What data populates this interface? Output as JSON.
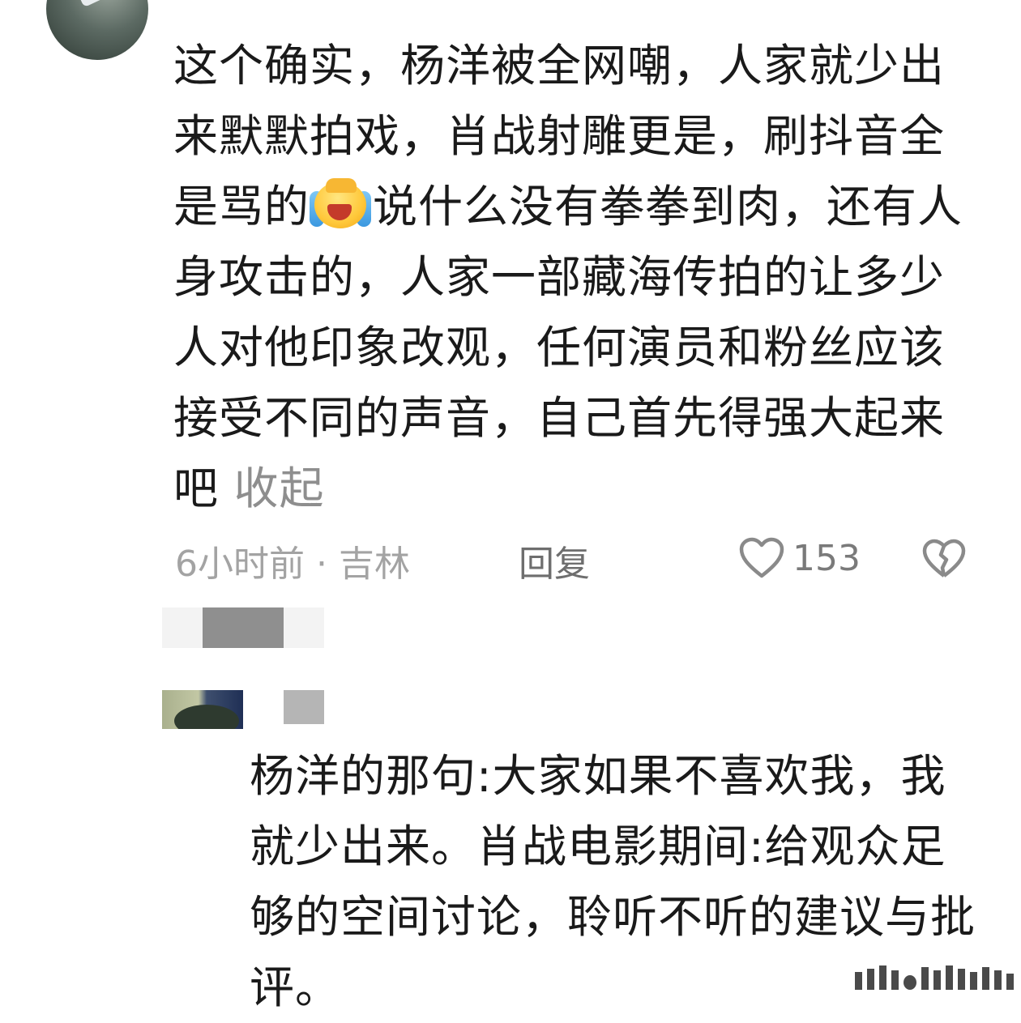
{
  "comment1": {
    "text_part1": "这个确实，杨洋被全网嘲，人家就少出来默默拍戏，肖战射雕更是，刷抖音全是骂的",
    "emoji_icon": "crying-laughing-emoji",
    "text_part2": "说什么没有拳拳到肉，还有人身攻击的，人家一部藏海传拍的让多少人对他印象改观，任何演员和粉丝应该接受不同的声音，自己首先得强大起来吧",
    "collapse_label": "收起",
    "time": "6小时前",
    "separator": "·",
    "location": "吉林",
    "reply_label": "回复",
    "like_count": "153"
  },
  "comment2": {
    "text": "杨洋的那句:大家如果不喜欢我，我就少出来。肖战电影期间:给观众足够的空间讨论，聆听不听的建议与批评。"
  }
}
